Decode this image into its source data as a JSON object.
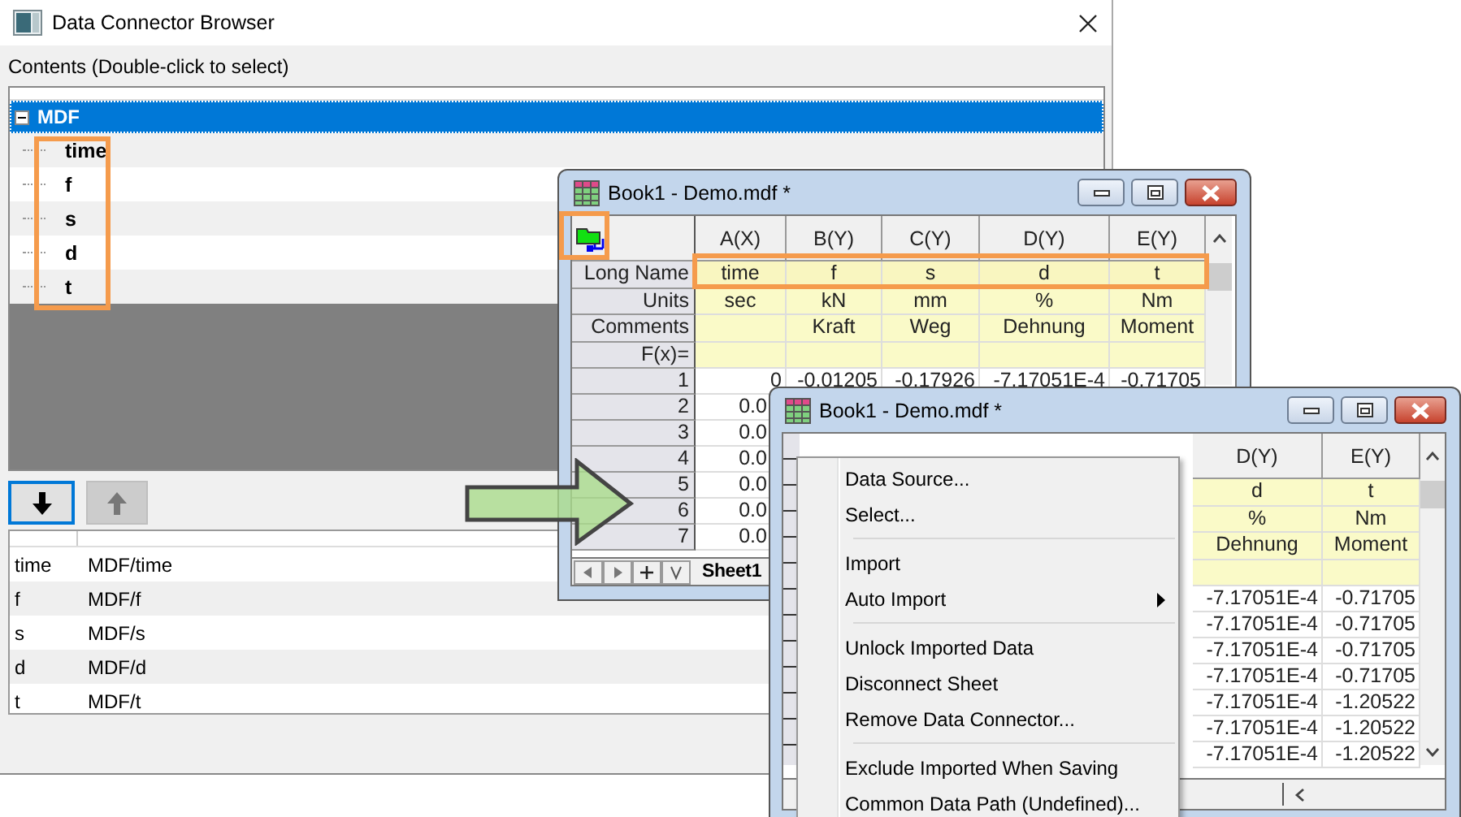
{
  "dialog": {
    "title": "Data Connector Browser",
    "contents_label": "Contents (Double-click to select)",
    "tree": {
      "label": "MDF",
      "expanded": true,
      "selected": true,
      "children": [
        {
          "label": "time"
        },
        {
          "label": "f"
        },
        {
          "label": "s"
        },
        {
          "label": "d"
        },
        {
          "label": "t"
        }
      ]
    },
    "move_buttons": [
      {
        "kind": "down",
        "disabled": false
      },
      {
        "kind": "up",
        "disabled": true
      }
    ],
    "selected_rows": [
      {
        "name": "time",
        "path": "MDF/time"
      },
      {
        "name": "f",
        "path": "MDF/f"
      },
      {
        "name": "s",
        "path": "MDF/s"
      },
      {
        "name": "d",
        "path": "MDF/d"
      },
      {
        "name": "t",
        "path": "MDF/t"
      }
    ]
  },
  "workbooks": [
    {
      "kind": "full",
      "title": "Book1 - Demo.mdf *",
      "meta_labels": [
        "Long Name",
        "Units",
        "Comments",
        "F(x)="
      ],
      "columns": [
        {
          "header": "A(X)",
          "long_name": "time",
          "units": "sec"
        },
        {
          "header": "B(Y)",
          "long_name": "f",
          "units": "kN",
          "comments": "Kraft"
        },
        {
          "header": "C(Y)",
          "long_name": "s",
          "units": "mm",
          "comments": "Weg"
        },
        {
          "header": "D(Y)",
          "long_name": "d",
          "units": "%",
          "comments": "Dehnung"
        },
        {
          "header": "E(Y)",
          "long_name": "t",
          "units": "Nm",
          "comments": "Moment"
        }
      ],
      "rows": [
        {
          "label": "1",
          "cells": [
            "0",
            "-0.01205",
            "-0.17926",
            "-7.17051E-4",
            "-0.71705"
          ]
        },
        {
          "label": "2",
          "cells": [
            "0.0"
          ]
        },
        {
          "label": "3",
          "cells": [
            "0.0"
          ]
        },
        {
          "label": "4",
          "cells": [
            "0.0"
          ]
        },
        {
          "label": "5",
          "cells": [
            "0.0"
          ]
        },
        {
          "label": "6",
          "cells": [
            "0.0"
          ]
        },
        {
          "label": "7",
          "cells": [
            "0.0"
          ]
        }
      ],
      "sheet_tab": "Sheet1"
    },
    {
      "kind": "partial",
      "title": "Book1 - Demo.mdf *",
      "columns": [
        {
          "header": "D(Y)",
          "long_name": "d",
          "units": "%",
          "comments": "Dehnung"
        },
        {
          "header": "E(Y)",
          "long_name": "t",
          "units": "Nm",
          "comments": "Moment"
        }
      ],
      "rows": [
        {
          "cells": [
            "-7.17051E-4",
            "-0.71705"
          ]
        },
        {
          "cells": [
            "-7.17051E-4",
            "-0.71705"
          ]
        },
        {
          "cells": [
            "-7.17051E-4",
            "-0.71705"
          ]
        },
        {
          "cells": [
            "-7.17051E-4",
            "-0.71705"
          ]
        },
        {
          "cells": [
            "-7.17051E-4",
            "-1.20522"
          ]
        },
        {
          "cells": [
            "-7.17051E-4",
            "-1.20522"
          ]
        },
        {
          "cells": [
            "-7.17051E-4",
            "-1.20522"
          ]
        }
      ]
    }
  ],
  "context_menu": {
    "items": [
      {
        "kind": "item",
        "label": "Data Source...",
        "submenu": false
      },
      {
        "kind": "item",
        "label": "Select...",
        "submenu": false
      },
      {
        "kind": "separator"
      },
      {
        "kind": "item",
        "label": "Import",
        "submenu": false
      },
      {
        "kind": "item",
        "label": "Auto Import",
        "submenu": true
      },
      {
        "kind": "separator"
      },
      {
        "kind": "item",
        "label": "Unlock Imported Data",
        "submenu": false
      },
      {
        "kind": "item",
        "label": "Disconnect Sheet",
        "submenu": false
      },
      {
        "kind": "item",
        "label": "Remove Data Connector...",
        "submenu": false
      },
      {
        "kind": "separator"
      },
      {
        "kind": "item",
        "label": "Exclude Imported When Saving",
        "submenu": false
      },
      {
        "kind": "item",
        "label": "Common Data Path (Undefined)...",
        "submenu": false
      }
    ]
  }
}
